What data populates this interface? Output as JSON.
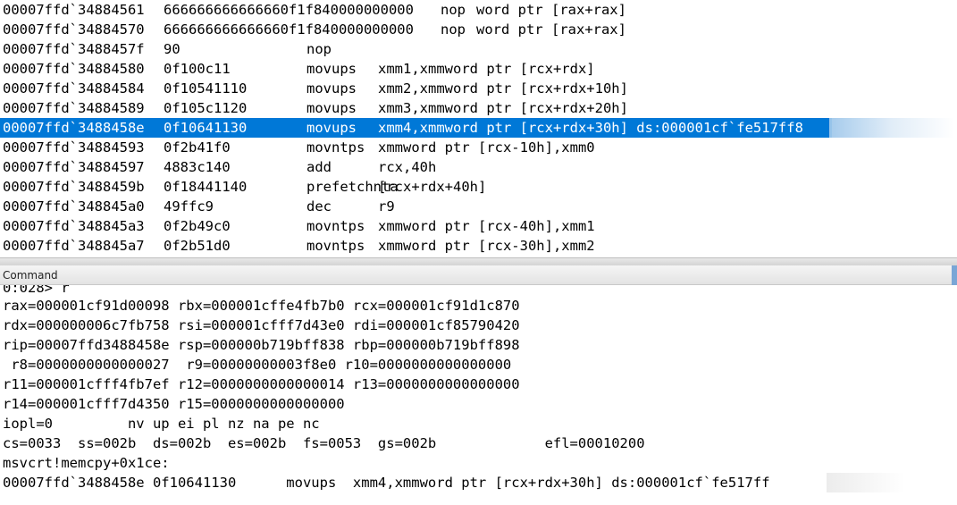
{
  "disassembly": {
    "lines": [
      {
        "addr": "00007ffd`34884561",
        "bytes": "666666666666660f1f840000000000",
        "mnem": "nop",
        "ops": "word ptr [rax+rax]",
        "compact": true
      },
      {
        "addr": "00007ffd`34884570",
        "bytes": "666666666666660f1f840000000000",
        "mnem": "nop",
        "ops": "word ptr [rax+rax]",
        "compact": true
      },
      {
        "addr": "00007ffd`3488457f",
        "bytes": "90",
        "mnem": "nop",
        "ops": ""
      },
      {
        "addr": "00007ffd`34884580",
        "bytes": "0f100c11",
        "mnem": "movups",
        "ops": "xmm1,xmmword ptr [rcx+rdx]"
      },
      {
        "addr": "00007ffd`34884584",
        "bytes": "0f10541110",
        "mnem": "movups",
        "ops": "xmm2,xmmword ptr [rcx+rdx+10h]"
      },
      {
        "addr": "00007ffd`34884589",
        "bytes": "0f105c1120",
        "mnem": "movups",
        "ops": "xmm3,xmmword ptr [rcx+rdx+20h]"
      },
      {
        "addr": "00007ffd`3488458e",
        "bytes": "0f10641130",
        "mnem": "movups",
        "ops": "xmm4,xmmword ptr [rcx+rdx+30h] ds:000001cf`fe517ff8",
        "selected": true
      },
      {
        "addr": "00007ffd`34884593",
        "bytes": "0f2b41f0",
        "mnem": "movntps",
        "ops": "xmmword ptr [rcx-10h],xmm0"
      },
      {
        "addr": "00007ffd`34884597",
        "bytes": "4883c140",
        "mnem": "add",
        "ops": "rcx,40h"
      },
      {
        "addr": "00007ffd`3488459b",
        "bytes": "0f18441140",
        "mnem": "prefetchnta",
        "ops": "[rcx+rdx+40h]"
      },
      {
        "addr": "00007ffd`348845a0",
        "bytes": "49ffc9",
        "mnem": "dec",
        "ops": "r9"
      },
      {
        "addr": "00007ffd`348845a3",
        "bytes": "0f2b49c0",
        "mnem": "movntps",
        "ops": "xmmword ptr [rcx-40h],xmm1"
      },
      {
        "addr": "00007ffd`348845a7",
        "bytes": "0f2b51d0",
        "mnem": "movntps",
        "ops": "xmmword ptr [rcx-30h],xmm2"
      }
    ]
  },
  "command_window": {
    "title": "Command",
    "output_lines": [
      "0:028> r",
      "rax=000001cf91d00098 rbx=000001cffe4fb7b0 rcx=000001cf91d1c870",
      "rdx=000000006c7fb758 rsi=000001cfff7d43e0 rdi=000001cf85790420",
      "rip=00007ffd3488458e rsp=000000b719bff838 rbp=000000b719bff898",
      " r8=0000000000000027  r9=00000000003f8e0 r10=0000000000000000",
      "r11=000001cfff4fb7ef r12=0000000000000014 r13=0000000000000000",
      "r14=000001cfff7d4350 r15=0000000000000000",
      "iopl=0         nv up ei pl nz na pe nc",
      "cs=0033  ss=002b  ds=002b  es=002b  fs=0053  gs=002b             efl=00010200",
      "msvcrt!memcpy+0x1ce:",
      "00007ffd`3488458e 0f10641130      movups  xmm4,xmmword ptr [rcx+rdx+30h] ds:000001cf`fe517ff"
    ]
  },
  "colors": {
    "selection": "#0078d7",
    "text": "#000000",
    "background": "#ffffff"
  }
}
